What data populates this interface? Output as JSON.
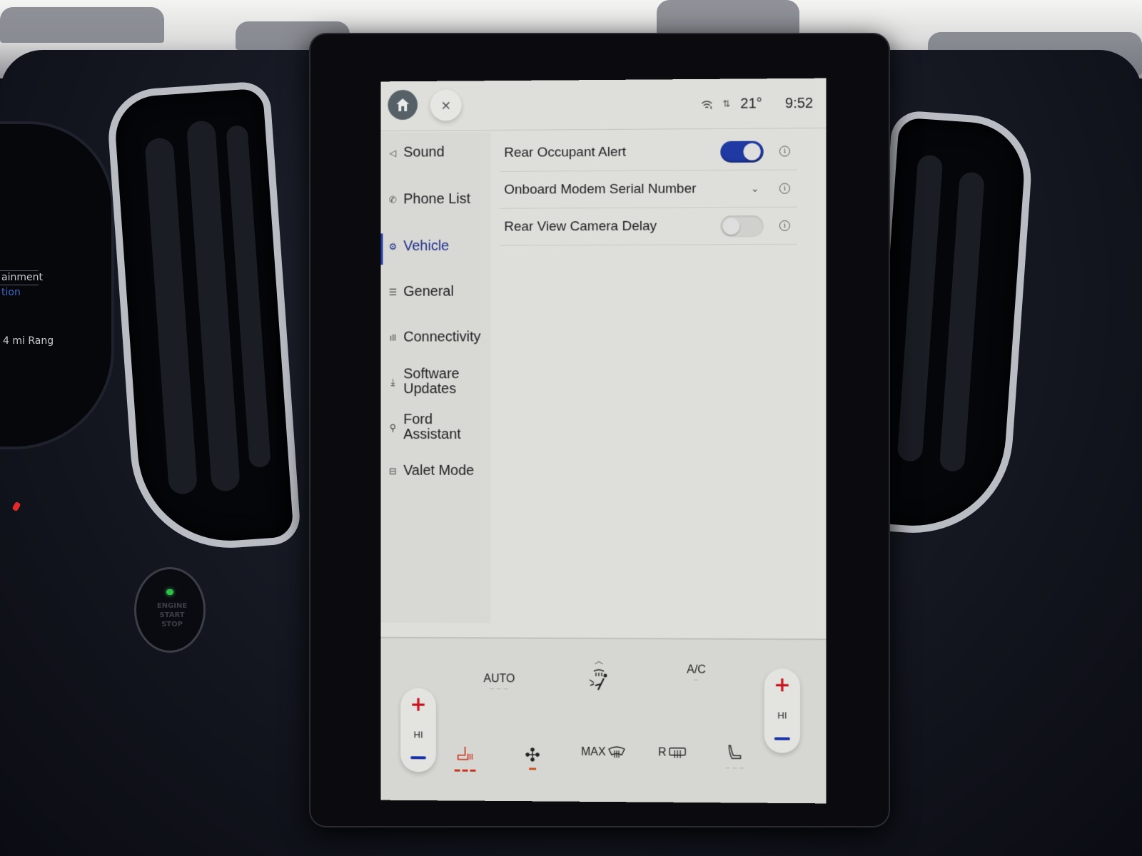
{
  "environment": {
    "cluster_lines": [
      "ainment",
      "tion",
      "4 mi Rang"
    ],
    "start_button": {
      "line1": "ENGINE",
      "line2": "START",
      "line3": "STOP"
    }
  },
  "status_bar": {
    "home_icon": "home-icon",
    "close_label": "×",
    "wifi_icon": "wifi-icon",
    "data_icon": "data-transfer-icon",
    "temperature": "21°",
    "time": "9:52"
  },
  "sidebar": {
    "active_index": 2,
    "items": [
      {
        "label": "Sound",
        "icon": "speaker-icon",
        "glyph": "◁"
      },
      {
        "label": "Phone List",
        "icon": "phone-icon",
        "glyph": "✆"
      },
      {
        "label": "Vehicle",
        "icon": "vehicle-settings-icon",
        "glyph": "⚙"
      },
      {
        "label": "General",
        "icon": "sliders-icon",
        "glyph": "☰"
      },
      {
        "label": "Connectivity",
        "icon": "signal-bars-icon",
        "glyph": "ıll"
      },
      {
        "label": "Software\nUpdates",
        "icon": "download-icon",
        "glyph": "⤓"
      },
      {
        "label": "Ford\nAssistant",
        "icon": "assistant-icon",
        "glyph": "⚲"
      },
      {
        "label": "Valet Mode",
        "icon": "valet-lock-icon",
        "glyph": "⊟"
      }
    ]
  },
  "settings": {
    "rows": [
      {
        "label": "Rear Occupant Alert",
        "control": "toggle",
        "value": true
      },
      {
        "label": "Onboard Modem Serial Number",
        "control": "dropdown",
        "expanded": false
      },
      {
        "label": "Rear View Camera Delay",
        "control": "toggle",
        "value": false
      }
    ],
    "info_label": "i",
    "chevron": "⌄"
  },
  "climate": {
    "left_temp": {
      "plus": "+",
      "level": "HI"
    },
    "right_temp": {
      "plus": "+",
      "level": "HI"
    },
    "auto_label": "AUTO",
    "ac_label": "A/C",
    "max_defrost_label": "MAX",
    "rear_defrost_label": "R",
    "airflow_expand_glyph": "︿",
    "fan_glyph": "✣",
    "defrost_glyph": "♨",
    "seat_glyph": "⑃",
    "indicator_dots": "— — —"
  },
  "colors": {
    "accent": "#1f3aa3",
    "active_text": "#1d2e8c",
    "heat_red": "#c8141e",
    "cool_blue": "#1c33a8",
    "screen_bg": "#dededa"
  }
}
